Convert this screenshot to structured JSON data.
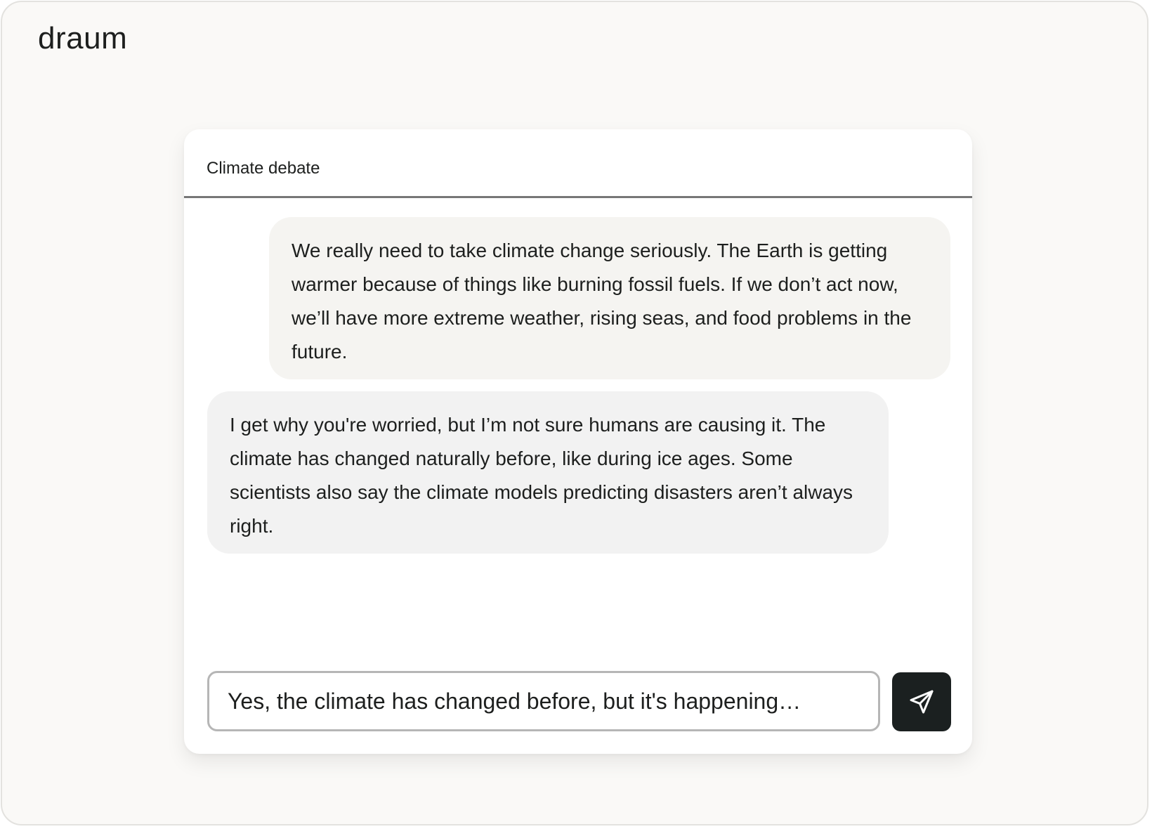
{
  "app": {
    "logo": "draum"
  },
  "chat": {
    "title": "Climate debate",
    "messages": [
      {
        "role": "user",
        "text": "We really need to take climate change seriously. The Earth is getting warmer because of things like burning fossil fuels. If we don’t act now, we’ll have more extreme weather, rising seas, and food problems in the future."
      },
      {
        "role": "other",
        "text": "I get why you're worried, but I’m not sure humans are causing it. The climate has changed naturally before, like during ice ages. Some scientists also say the climate models predicting disasters aren’t always right."
      }
    ]
  },
  "composer": {
    "value": "Yes, the climate has changed before, but it's happening…",
    "send_icon": "send-icon"
  },
  "colors": {
    "send_button_bg": "#1b2020",
    "user_bubble_bg": "#f5f4f1",
    "other_bubble_bg": "#f2f2f2"
  }
}
